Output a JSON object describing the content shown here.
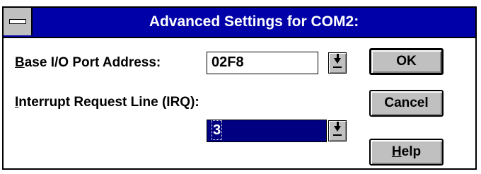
{
  "dialog": {
    "title": "Advanced Settings for COM2:"
  },
  "base_io": {
    "label_accel": "B",
    "label_rest": "ase I/O Port Address:",
    "value": "02F8"
  },
  "irq": {
    "label_accel": "I",
    "label_rest": "nterrupt Request Line (IRQ):",
    "value": "3"
  },
  "buttons": {
    "ok": "OK",
    "cancel": "Cancel",
    "help_accel": "H",
    "help_rest": "elp"
  },
  "icons": {
    "system_menu": "system-menu-icon",
    "dropdown": "dropdown-arrow-icon"
  },
  "colors": {
    "titlebar": "#0000a8",
    "selection": "#000080",
    "button_face": "#c0c0c0"
  }
}
